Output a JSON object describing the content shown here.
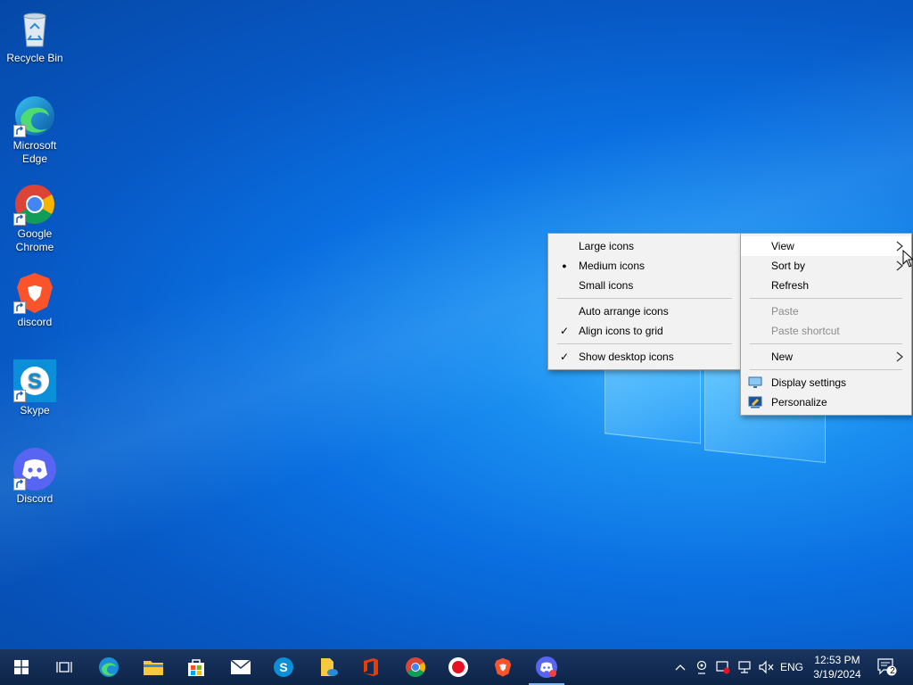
{
  "desktop": {
    "icons": [
      {
        "label": "Recycle Bin"
      },
      {
        "label": "Microsoft Edge"
      },
      {
        "label": "Google Chrome"
      },
      {
        "label": "discord"
      },
      {
        "label": "Skype"
      },
      {
        "label": "Discord"
      }
    ]
  },
  "context_menu": {
    "items": {
      "view": "View",
      "sort_by": "Sort by",
      "refresh": "Refresh",
      "paste": "Paste",
      "paste_shortcut": "Paste shortcut",
      "new": "New",
      "display_settings": "Display settings",
      "personalize": "Personalize"
    }
  },
  "view_submenu": {
    "items": {
      "large_icons": "Large icons",
      "medium_icons": "Medium icons",
      "small_icons": "Small icons",
      "auto_arrange": "Auto arrange icons",
      "align_grid": "Align icons to grid",
      "show_desktop_icons": "Show desktop icons"
    },
    "marks": {
      "medium_icons": "●",
      "align_grid": "✓",
      "show_desktop_icons": "✓"
    }
  },
  "taskbar": {
    "language": "ENG",
    "time": "12:53 PM",
    "date": "3/19/2024",
    "notification_count": "2"
  },
  "colors": {
    "accent": "#0078d7",
    "taskbar_bg": "#0d2448"
  }
}
